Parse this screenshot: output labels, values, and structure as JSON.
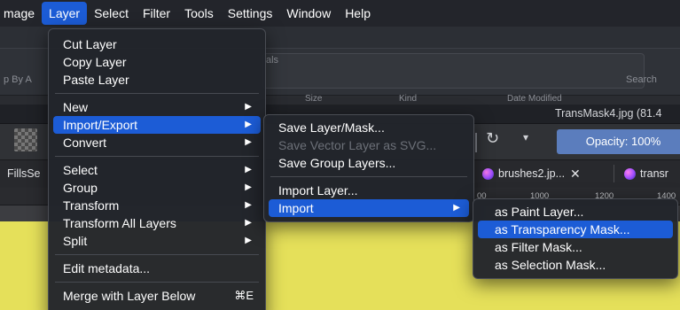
{
  "menubar": {
    "items": [
      "mage",
      "Layer",
      "Select",
      "Filter",
      "Tools",
      "Settings",
      "Window",
      "Help"
    ],
    "active_index": 1
  },
  "background": {
    "sort_label": "p By  A",
    "panel_label": "als",
    "search_label": "Search",
    "col_size": "Size",
    "col_kind": "Kind",
    "col_date": "Date Modified",
    "window_title": "TransMask4.jpg (81.4",
    "opacity_label": "Opacity: 100%",
    "tab_left": "FillsSe",
    "tab1": "brushes2.jp...",
    "tab1_close": "✕",
    "tab2": "transr",
    "ruler": [
      "00",
      "1000",
      "1200",
      "1400"
    ],
    "canvas_color": "#e5e05a"
  },
  "layer_menu": {
    "cut": "Cut Layer",
    "copy": "Copy Layer",
    "paste": "Paste Layer",
    "new": "New",
    "import_export": "Import/Export",
    "convert": "Convert",
    "select": "Select",
    "group": "Group",
    "transform": "Transform",
    "transform_all": "Transform All Layers",
    "split": "Split",
    "edit_metadata": "Edit metadata...",
    "merge_below": "Merge with Layer Below",
    "merge_shortcut": "⌘E"
  },
  "import_export_menu": {
    "save_layer_mask": "Save Layer/Mask...",
    "save_vector_svg": "Save Vector Layer as SVG...",
    "save_group_layers": "Save Group Layers...",
    "import_layer": "Import Layer...",
    "import": "Import"
  },
  "import_menu": {
    "paint_layer": "as Paint Layer...",
    "transparency_mask": "as Transparency Mask...",
    "filter_mask": "as Filter Mask...",
    "selection_mask": "as Selection Mask..."
  },
  "colors": {
    "accent": "#1c5cd6",
    "menubar_bg": "#23252b",
    "menu_bg": "#22252b",
    "opacity_bg": "#5b7dbd"
  }
}
